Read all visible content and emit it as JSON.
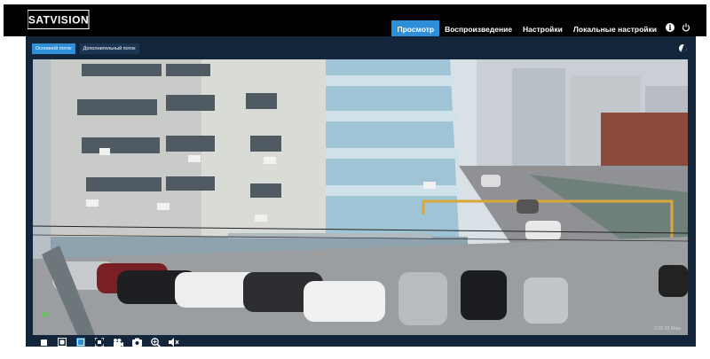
{
  "brand": {
    "logo_text": "SATVISION"
  },
  "nav": {
    "items": [
      {
        "label": "Просмотр",
        "active": true
      },
      {
        "label": "Воспроизведение",
        "active": false
      },
      {
        "label": "Настройки",
        "active": false
      },
      {
        "label": "Локальные настройки",
        "active": false
      }
    ],
    "icons": [
      "info-icon",
      "power-icon"
    ]
  },
  "streams": {
    "main_label": "Основной поток",
    "sub_label": "Дополнительный поток",
    "active": "main"
  },
  "video": {
    "status_char": "M",
    "bitrate": "1102.20 Kbps"
  },
  "toolbar": {
    "icons": [
      "stop-icon",
      "window-icon",
      "aspect-icon",
      "fullscreen-icon",
      "record-icon",
      "snapshot-icon",
      "zoom-icon",
      "audio-icon"
    ]
  },
  "colors": {
    "accent": "#2f8fd6",
    "panel": "#13253b",
    "topbar": "#000000"
  }
}
